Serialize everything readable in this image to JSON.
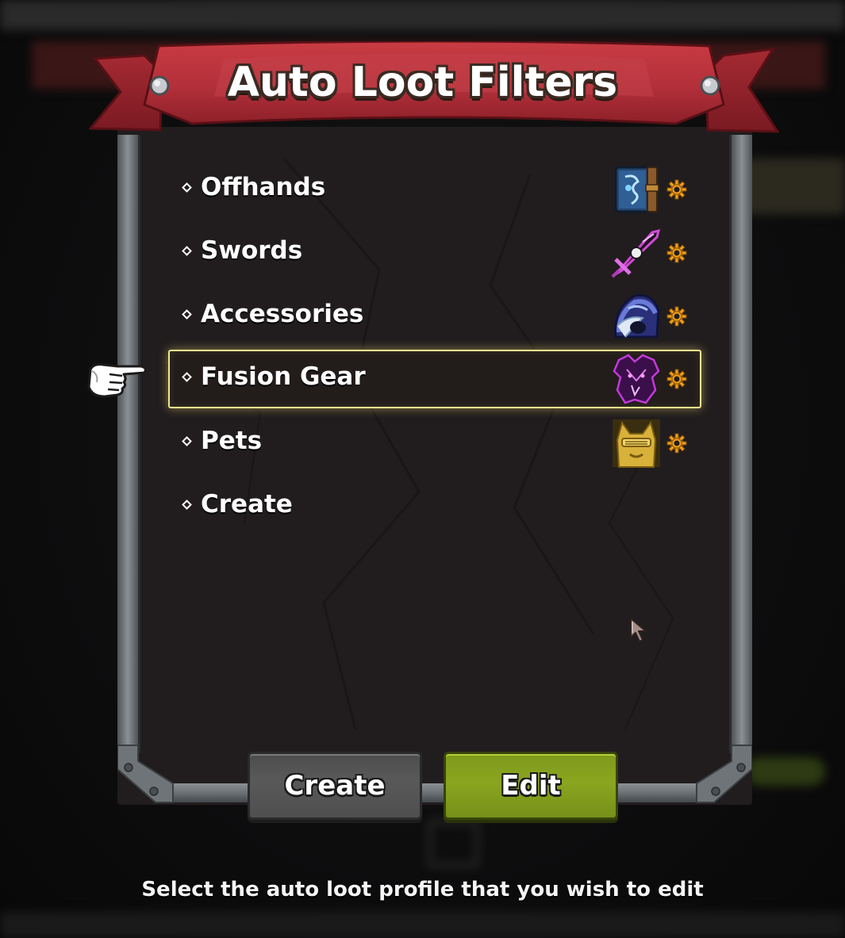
{
  "window": {
    "title": "Auto Loot Filters",
    "hint": "Select the auto loot profile that you wish to edit"
  },
  "profiles": [
    {
      "label": "Offhands",
      "icon": "spellbook-icon",
      "has_settings": true,
      "selected": false
    },
    {
      "label": "Swords",
      "icon": "sword-icon",
      "has_settings": true,
      "selected": false
    },
    {
      "label": "Accessories",
      "icon": "hood-icon",
      "has_settings": true,
      "selected": false
    },
    {
      "label": "Fusion Gear",
      "icon": "shadow-cloak-icon",
      "has_settings": true,
      "selected": true
    },
    {
      "label": "Pets",
      "icon": "golden-pet-icon",
      "has_settings": true,
      "selected": false
    },
    {
      "label": "Create",
      "icon": "",
      "has_settings": false,
      "selected": false
    }
  ],
  "buttons": {
    "create_label": "Create",
    "edit_label": "Edit"
  },
  "colors": {
    "banner_red": "#b8333a",
    "panel_bg": "#211d1e",
    "frame_steel": "#7d8286",
    "selection_glow": "#f1e58e",
    "edit_green": "#86a11e",
    "create_grey": "#545454",
    "gear_orange": "#f2a01a"
  }
}
